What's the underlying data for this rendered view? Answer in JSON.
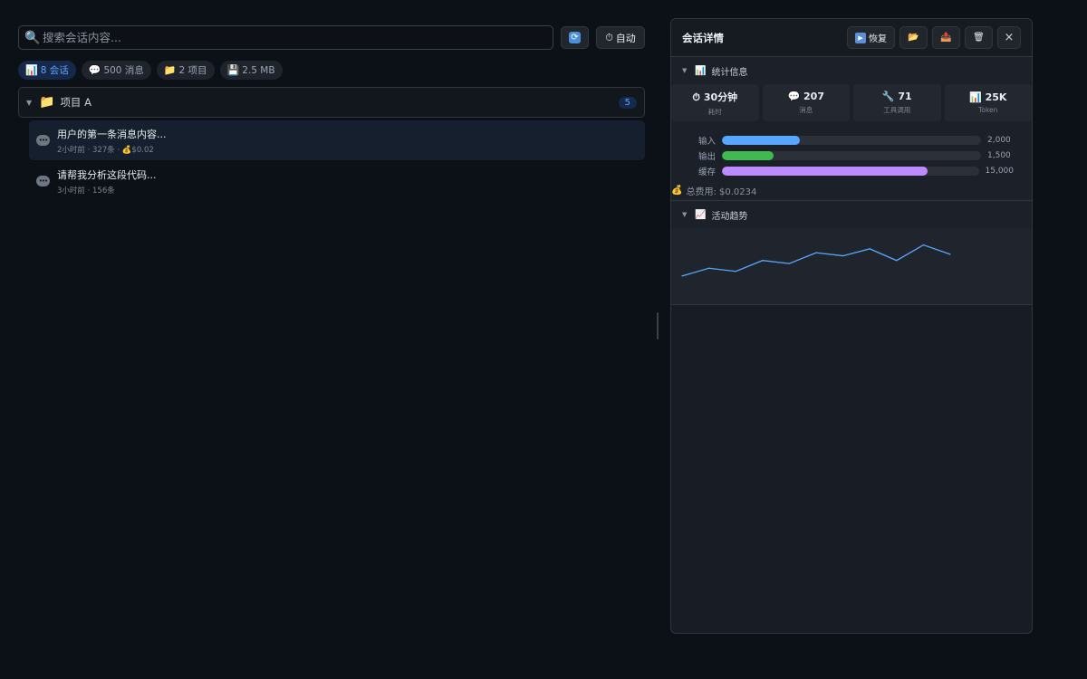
{
  "search": {
    "placeholder": "搜索会话内容..."
  },
  "toolbar": {
    "auto_label": "自动"
  },
  "stats": [
    {
      "icon": "📊",
      "label": "8 会话"
    },
    {
      "icon": "💬",
      "label": "500 消息"
    },
    {
      "icon": "📁",
      "label": "2 项目"
    },
    {
      "icon": "💾",
      "label": "2.5 MB"
    }
  ],
  "project": {
    "name": "项目 A",
    "count": "5"
  },
  "conversations": [
    {
      "title": "用户的第一条消息内容...",
      "meta": "2小时前 · 327条 · 💰$0.02"
    },
    {
      "title": "请帮我分析这段代码...",
      "meta": "3小时前 · 156条"
    }
  ],
  "panel": {
    "title": "会话详情",
    "resume_label": "恢复",
    "close_label": "×",
    "stats_section": "统计信息",
    "trend_section": "活动趋势",
    "cards": [
      {
        "icon": "⏱",
        "value": "30分钟",
        "label": "耗时"
      },
      {
        "icon": "💬",
        "value": "207",
        "label": "消息"
      },
      {
        "icon": "🔧",
        "value": "71",
        "label": "工具调用"
      },
      {
        "icon": "📊",
        "value": "25K",
        "label": "Token"
      }
    ],
    "tokens": [
      {
        "label": "输入",
        "value": "2,000",
        "fraction": 0.3,
        "color": "#58a6ff"
      },
      {
        "label": "输出",
        "value": "1,500",
        "fraction": 0.2,
        "color": "#3fb950"
      },
      {
        "label": "缓存",
        "value": "15,000",
        "fraction": 0.8,
        "color": "#bc8cff"
      }
    ],
    "total_cost": "总费用: $0.0234"
  },
  "chart_data": {
    "type": "line",
    "x": [
      1,
      2,
      3,
      4,
      5,
      6,
      7,
      8,
      9,
      10,
      11
    ],
    "values": [
      2,
      3,
      2.6,
      4,
      3.6,
      5,
      4.6,
      5.5,
      4,
      6,
      4.8
    ],
    "color": "#58a6ff",
    "title": "",
    "xlabel": "",
    "ylabel": "",
    "ylim": [
      0,
      7
    ],
    "grid": false
  }
}
